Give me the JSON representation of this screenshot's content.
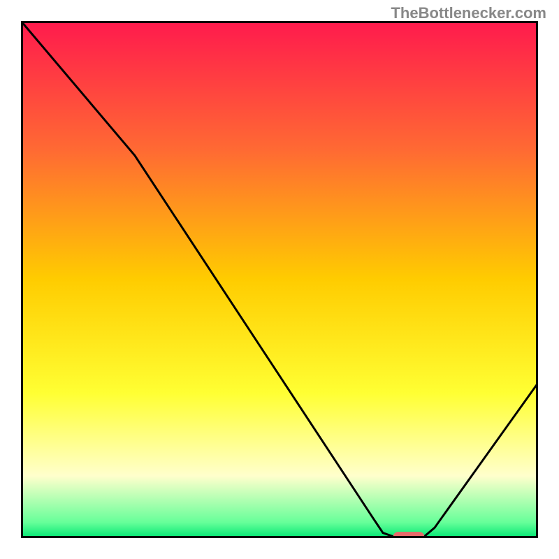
{
  "watermark": "TheBottlenecker.com",
  "chart_data": {
    "type": "line",
    "title": "",
    "xlabel": "",
    "ylabel": "",
    "xlim": [
      0,
      100
    ],
    "ylim": [
      0,
      100
    ],
    "background": "rainbow-gradient-vertical",
    "gradient_stops": [
      {
        "offset": 0.0,
        "color": "#ff1a4d"
      },
      {
        "offset": 0.25,
        "color": "#ff6a33"
      },
      {
        "offset": 0.5,
        "color": "#ffcc00"
      },
      {
        "offset": 0.72,
        "color": "#ffff33"
      },
      {
        "offset": 0.88,
        "color": "#ffffcc"
      },
      {
        "offset": 0.97,
        "color": "#66ff99"
      },
      {
        "offset": 1.0,
        "color": "#00e673"
      }
    ],
    "series": [
      {
        "name": "curve",
        "color": "#000000",
        "points": [
          {
            "x": 0,
            "y": 100
          },
          {
            "x": 22,
            "y": 74
          },
          {
            "x": 68,
            "y": 4
          },
          {
            "x": 70,
            "y": 1
          },
          {
            "x": 72,
            "y": 0.3
          },
          {
            "x": 78,
            "y": 0.3
          },
          {
            "x": 80,
            "y": 2
          },
          {
            "x": 100,
            "y": 30
          }
        ]
      }
    ],
    "marker": {
      "x": 75,
      "y": 0.3,
      "width": 6,
      "height": 1.8,
      "color": "#e86a6a",
      "shape": "rounded-rect"
    }
  }
}
